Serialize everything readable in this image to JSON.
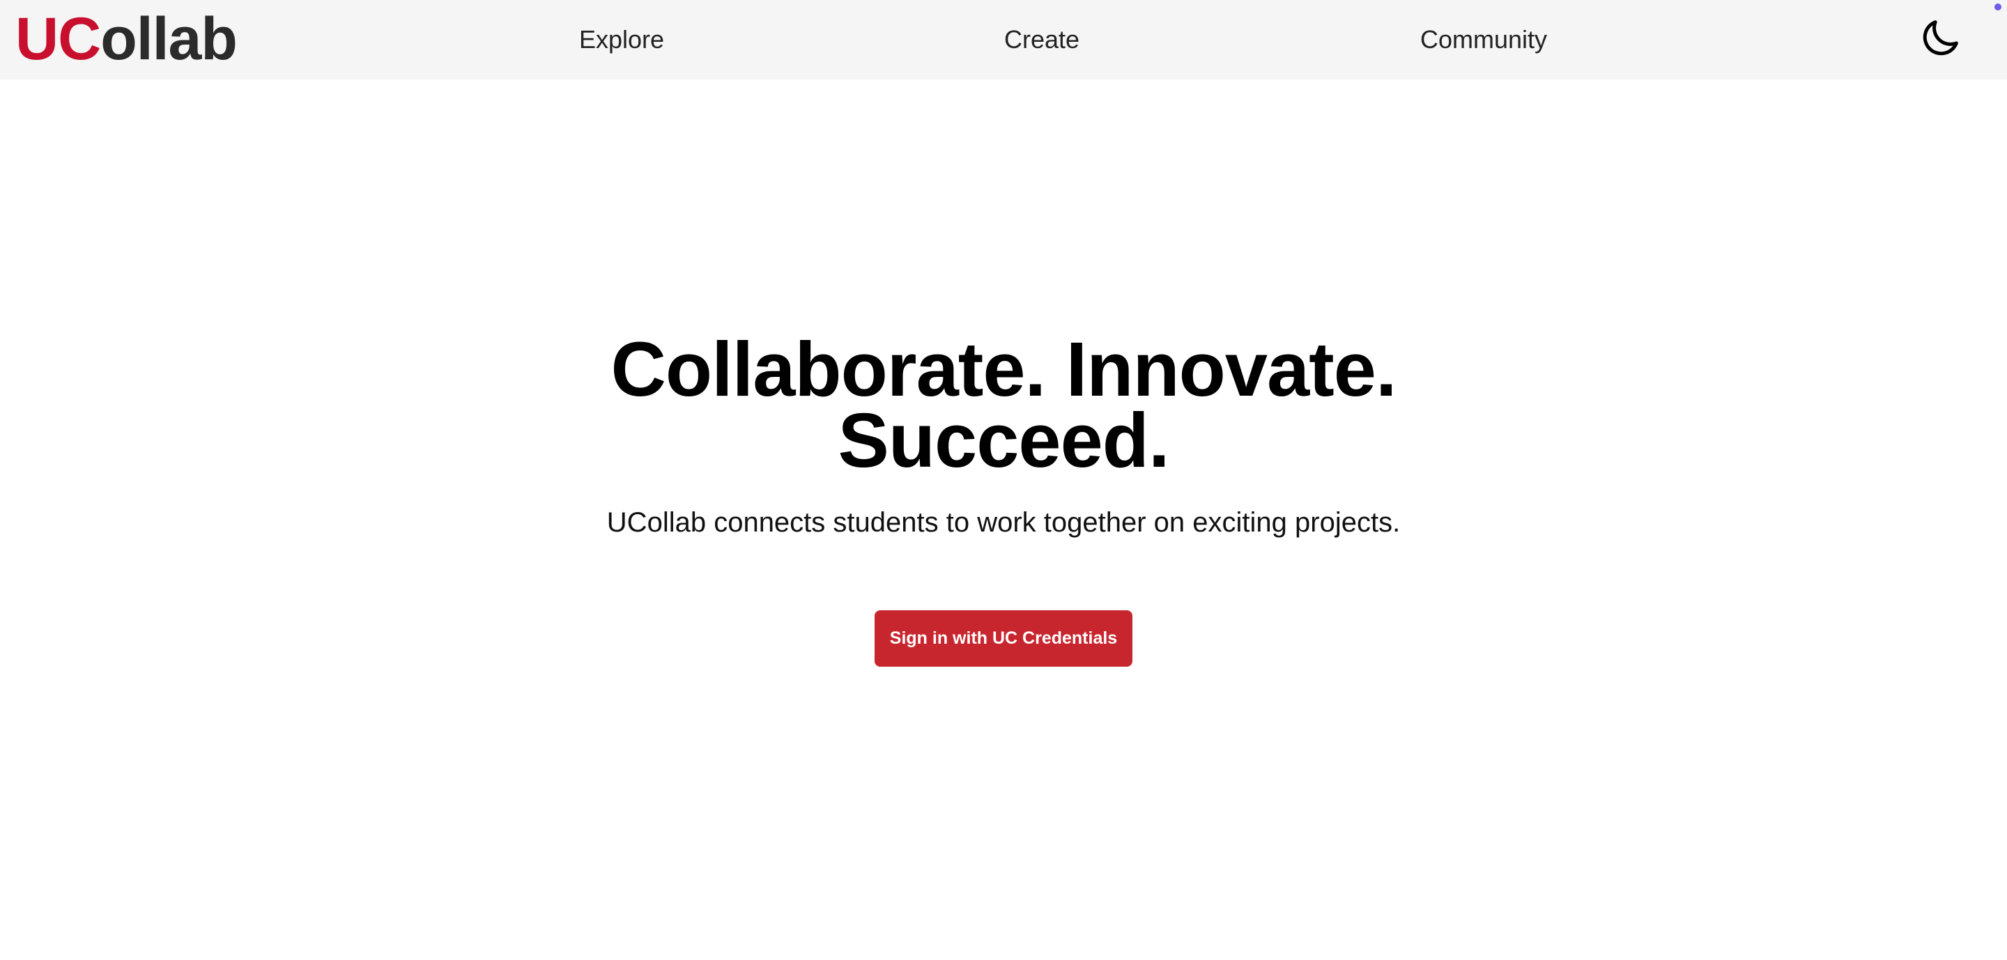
{
  "header": {
    "logo": {
      "part1": "UC",
      "part2": "ollab"
    },
    "nav": [
      {
        "label": "Explore"
      },
      {
        "label": "Create"
      },
      {
        "label": "Community"
      }
    ],
    "theme_toggle_icon": "moon-icon"
  },
  "hero": {
    "title_line1": "Collaborate. Innovate.",
    "title_line2": "Succeed.",
    "subtitle": "UCollab connects students to work together on exciting projects.",
    "cta_label": "Sign in with UC Credentials"
  },
  "colors": {
    "brand_red": "#c8102e",
    "button_red": "#c8262e",
    "header_bg": "#f5f5f5",
    "text_dark": "#2b2b2b"
  }
}
